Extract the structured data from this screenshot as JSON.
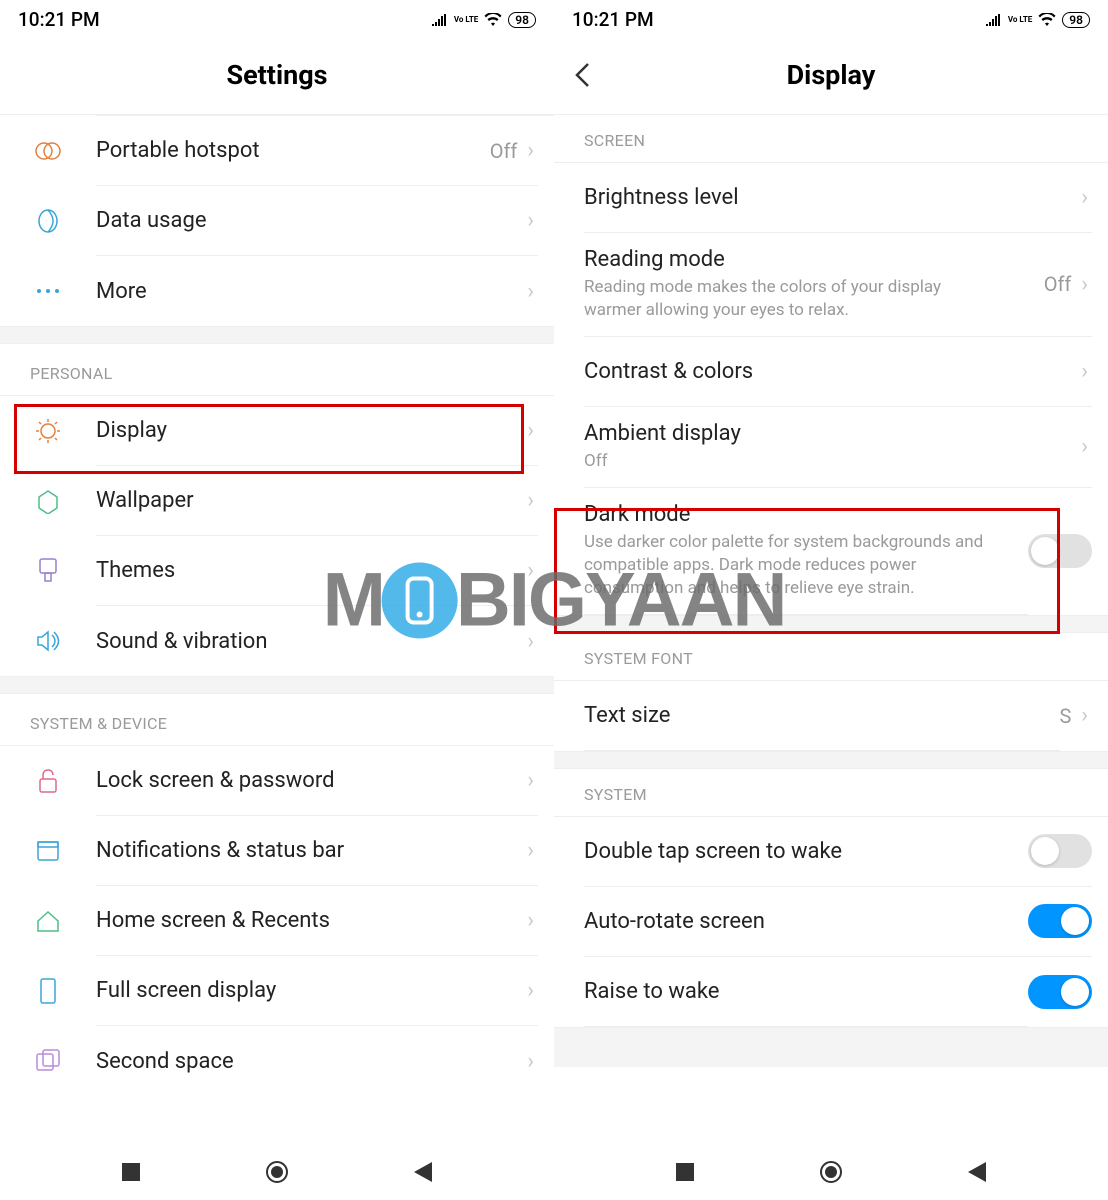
{
  "status": {
    "time": "10:21 PM",
    "volte": "Vo LTE",
    "battery": "98"
  },
  "left": {
    "title": "Settings",
    "items": {
      "hotspot": {
        "label": "Portable hotspot",
        "value": "Off"
      },
      "data": {
        "label": "Data usage"
      },
      "more": {
        "label": "More"
      }
    },
    "sections": {
      "personal": "PERSONAL",
      "system_device": "SYSTEM & DEVICE"
    },
    "personal": {
      "display": {
        "label": "Display"
      },
      "wallpaper": {
        "label": "Wallpaper"
      },
      "themes": {
        "label": "Themes"
      },
      "sound": {
        "label": "Sound & vibration"
      }
    },
    "system": {
      "lock": {
        "label": "Lock screen & password"
      },
      "notif": {
        "label": "Notifications & status bar"
      },
      "home": {
        "label": "Home screen & Recents"
      },
      "full": {
        "label": "Full screen display"
      },
      "second": {
        "label": "Second space"
      }
    }
  },
  "right": {
    "title": "Display",
    "sections": {
      "screen": "SCREEN",
      "system_font": "SYSTEM FONT",
      "system": "SYSTEM"
    },
    "brightness": {
      "label": "Brightness level"
    },
    "reading": {
      "label": "Reading mode",
      "sub": "Reading mode makes the colors of your display warmer allowing your eyes to relax.",
      "value": "Off"
    },
    "contrast": {
      "label": "Contrast & colors"
    },
    "ambient": {
      "label": "Ambient display",
      "sub": "Off"
    },
    "dark": {
      "label": "Dark mode",
      "sub": "Use darker color palette for system backgrounds and compatible apps. Dark mode reduces power consumption and helps to relieve eye strain."
    },
    "textsize": {
      "label": "Text size",
      "value": "S"
    },
    "doubletap": {
      "label": "Double tap screen to wake"
    },
    "autorotate": {
      "label": "Auto-rotate screen"
    },
    "raise": {
      "label": "Raise to wake"
    }
  },
  "watermark": {
    "pre": "M",
    "post": "BIGYAAN"
  }
}
